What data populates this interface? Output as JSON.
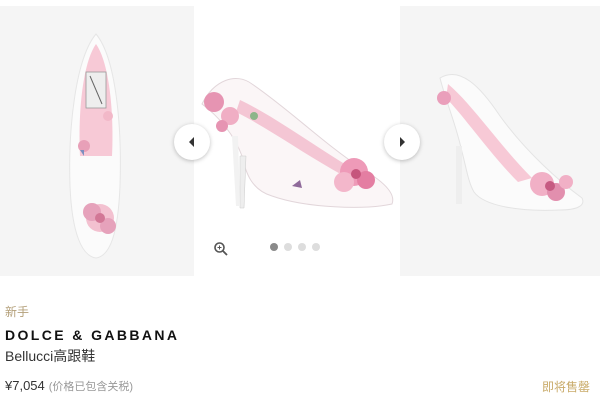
{
  "gallery": {
    "images": [
      "product-image-top-view",
      "product-image-side-view",
      "product-image-angle-view"
    ],
    "active_index": 0,
    "dot_count": 4,
    "icons": {
      "prev": "chevron-left-icon",
      "next": "chevron-right-icon",
      "zoom": "zoom-icon"
    }
  },
  "product": {
    "tag": "新手",
    "brand": "DOLCE & GABBANA",
    "name": "Bellucci高跟鞋",
    "price": "¥7,054",
    "tax_note": "(价格已包含关税)",
    "status": "即将售罄"
  },
  "colors": {
    "accent_gold": "#c9ab6a",
    "tag_gold": "#b4a07a",
    "shoe_pink": "#f0b6c8",
    "rose": "#e089a8"
  }
}
